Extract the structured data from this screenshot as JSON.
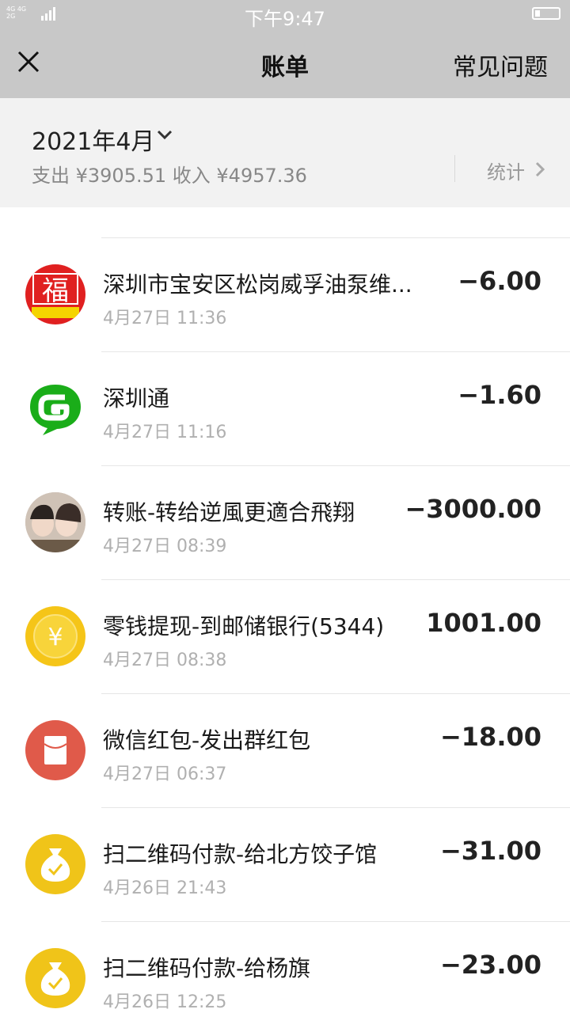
{
  "statusbar": {
    "network_top": "4G 4G",
    "network_bottom": "2G",
    "time": "下午9:47",
    "battery_level": 0.2
  },
  "nav": {
    "title": "账单",
    "faq": "常见问题",
    "close_icon": "close-icon"
  },
  "summary": {
    "month": "2021年4月",
    "stats_text": "支出 ¥3905.51 收入 ¥4957.36",
    "stats_button": "统计"
  },
  "transactions": [
    {
      "title": "深圳市宝安区松岗威孚油泵维...",
      "time": "4月27日 11:36",
      "amount": "−6.00",
      "icon": "fu-merchant-icon"
    },
    {
      "title": "深圳通",
      "time": "4月27日 11:16",
      "amount": "−1.60",
      "icon": "shenzhentong-icon"
    },
    {
      "title": "转账-转给逆風更適合飛翔",
      "time": "4月27日 08:39",
      "amount": "−3000.00",
      "icon": "user-photo-avatar"
    },
    {
      "title": "零钱提现-到邮储银行(5344)",
      "time": "4月27日 08:38",
      "amount": "1001.00",
      "icon": "yuan-coin-icon"
    },
    {
      "title": "微信红包-发出群红包",
      "time": "4月27日 06:37",
      "amount": "−18.00",
      "icon": "red-envelope-icon"
    },
    {
      "title": "扫二维码付款-给北方饺子馆",
      "time": "4月26日 21:43",
      "amount": "−31.00",
      "icon": "money-bag-icon"
    },
    {
      "title": "扫二维码付款-给杨旗",
      "time": "4月26日 12:25",
      "amount": "−23.00",
      "icon": "money-bag-icon"
    }
  ],
  "colors": {
    "header_bg": "#c8c8c8",
    "summary_bg": "#f2f2f2",
    "fu_red": "#e02020",
    "green": "#1aad19",
    "coin_yellow": "#f5c518",
    "envelope_red": "#e05a4a",
    "bag_yellow": "#f0c419"
  }
}
